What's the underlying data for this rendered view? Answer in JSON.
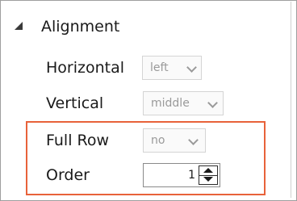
{
  "section": {
    "title": "Alignment",
    "icon": "collapse-triangle-icon"
  },
  "fields": {
    "horizontal": {
      "label": "Horizontal",
      "value": "left"
    },
    "vertical": {
      "label": "Vertical",
      "value": "middle"
    },
    "full_row": {
      "label": "Full Row",
      "value": "no"
    },
    "order": {
      "label": "Order",
      "value": "1"
    }
  },
  "colors": {
    "highlight": "#e8623a",
    "disabled_text": "#9a9a9a"
  }
}
